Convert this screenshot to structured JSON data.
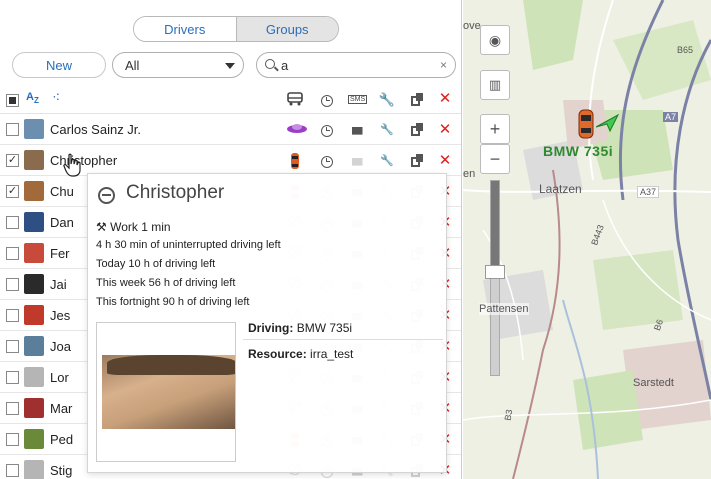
{
  "tabs": {
    "drivers": "Drivers",
    "groups": "Groups"
  },
  "toolbar": {
    "new_label": "New",
    "filter_value": "All",
    "search_value": "a",
    "clear_glyph": "×"
  },
  "header": {
    "sort_icon": "A↓Z",
    "group_icon": "⋯"
  },
  "drivers": [
    {
      "name": "Carlos Sainz Jr.",
      "checked": false,
      "vehicle": "purple-car",
      "avatar_color": "#6c8fb0"
    },
    {
      "name": "Christopher",
      "checked": true,
      "vehicle": "red-car",
      "avatar_color": "#8a6b4e"
    },
    {
      "name": "Chu",
      "checked": true,
      "vehicle": "red-car",
      "avatar_color": "#a26a3b"
    },
    {
      "name": "Dan",
      "checked": false,
      "vehicle": "none",
      "avatar_color": "#2d4f84"
    },
    {
      "name": "Fer",
      "checked": false,
      "vehicle": "none",
      "avatar_color": "#c74a3b"
    },
    {
      "name": "Jai",
      "checked": false,
      "vehicle": "none",
      "avatar_color": "#2a2a2a"
    },
    {
      "name": "Jes",
      "checked": false,
      "vehicle": "none",
      "avatar_color": "#c0392b"
    },
    {
      "name": "Joa",
      "checked": false,
      "vehicle": "none",
      "avatar_color": "#5b7f9a"
    },
    {
      "name": "Lor",
      "checked": false,
      "vehicle": "none",
      "avatar_color": "#b5b5b5"
    },
    {
      "name": "Mar",
      "checked": false,
      "vehicle": "none",
      "avatar_color": "#a03030"
    },
    {
      "name": "Ped",
      "checked": false,
      "vehicle": "red-car-faded",
      "avatar_color": "#6a8a3a"
    },
    {
      "name": "Stig",
      "checked": false,
      "vehicle": "none",
      "avatar_color": "#b5b5b5"
    }
  ],
  "popup": {
    "title": "Christopher",
    "work": "Work 1 min",
    "lines": [
      "4 h 30 min of uninterrupted driving left",
      "Today 10 h of driving left",
      "This week 56 h of driving left",
      "This fortnight 90 h of driving left"
    ],
    "driving_label": "Driving:",
    "driving_value": "BMW 735i",
    "resource_label": "Resource:",
    "resource_value": "irra_test"
  },
  "map": {
    "car_label": "BMW 735i",
    "places": [
      "Laatzen",
      "Pattensen",
      "Sarstedt",
      "A37",
      "A7",
      "B65",
      "B443",
      "B6",
      "B3",
      "en",
      "ove"
    ],
    "zoom_level": 0.43
  }
}
